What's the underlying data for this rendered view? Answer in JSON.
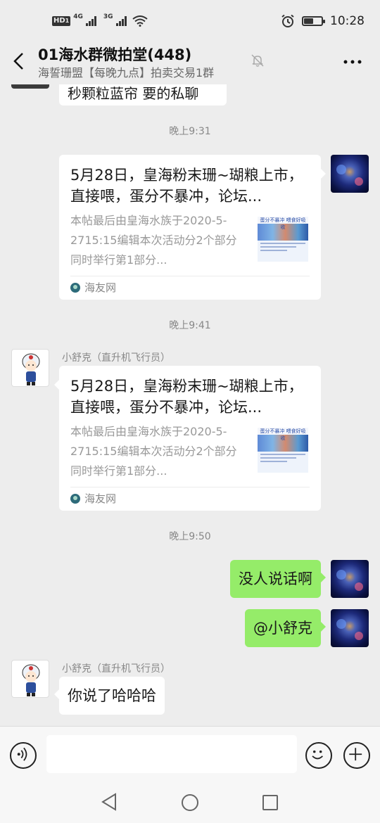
{
  "status_bar": {
    "hd": "HD",
    "hd_sub": "1",
    "net1": "4G",
    "net2": "3G",
    "time": "10:28",
    "battery_level": 0.55
  },
  "header": {
    "title": "01海水群微拍堂(448)",
    "subtitle": "海誓珊盟【每晚九点】拍卖交易1群",
    "icons": [
      "back-arrow-icon",
      "mute-bell-icon",
      "more-dots-icon"
    ]
  },
  "chat": {
    "prev_partial_text": "秒颗粒蓝帘 要的私聊",
    "messages": [
      {
        "type": "timestamp",
        "text": "晚上9:31"
      },
      {
        "type": "link_card",
        "side": "right",
        "title": "5月28日，皇海粉末珊~瑚粮上市，直接喂，蛋分不暴冲，论坛...",
        "desc": "本帖最后由皇海水族于2020-5-2715:15编辑本次活动分2个部分同时举行第1部分...",
        "source": "海友网",
        "thumb_header": "蛋分不暴冲  喂食好吸收"
      },
      {
        "type": "timestamp",
        "text": "晚上9:41"
      },
      {
        "type": "link_card",
        "side": "left",
        "sender": "小舒克（直升机飞行员）",
        "title": "5月28日，皇海粉末珊~瑚粮上市，直接喂，蛋分不暴冲，论坛...",
        "desc": "本帖最后由皇海水族于2020-5-2715:15编辑本次活动分2个部分同时举行第1部分...",
        "source": "海友网",
        "thumb_header": "蛋分不暴冲  喂食好吸收"
      },
      {
        "type": "timestamp",
        "text": "晚上9:50"
      },
      {
        "type": "text",
        "side": "right",
        "text": "没人说话啊"
      },
      {
        "type": "text",
        "side": "right",
        "text": "@小舒克"
      },
      {
        "type": "text",
        "side": "left",
        "sender": "小舒克（直升机飞行员）",
        "text": "你说了哈哈哈"
      }
    ]
  },
  "input_bar": {
    "placeholder": "",
    "icons": [
      "voice-icon",
      "emoji-icon",
      "plus-icon"
    ]
  },
  "nav_bar": {
    "icons": [
      "nav-back-icon",
      "nav-home-icon",
      "nav-recent-icon"
    ]
  },
  "colors": {
    "background": "#ededed",
    "green_bubble": "#95ec69",
    "white_bubble": "#ffffff",
    "timestamp": "#888888"
  }
}
